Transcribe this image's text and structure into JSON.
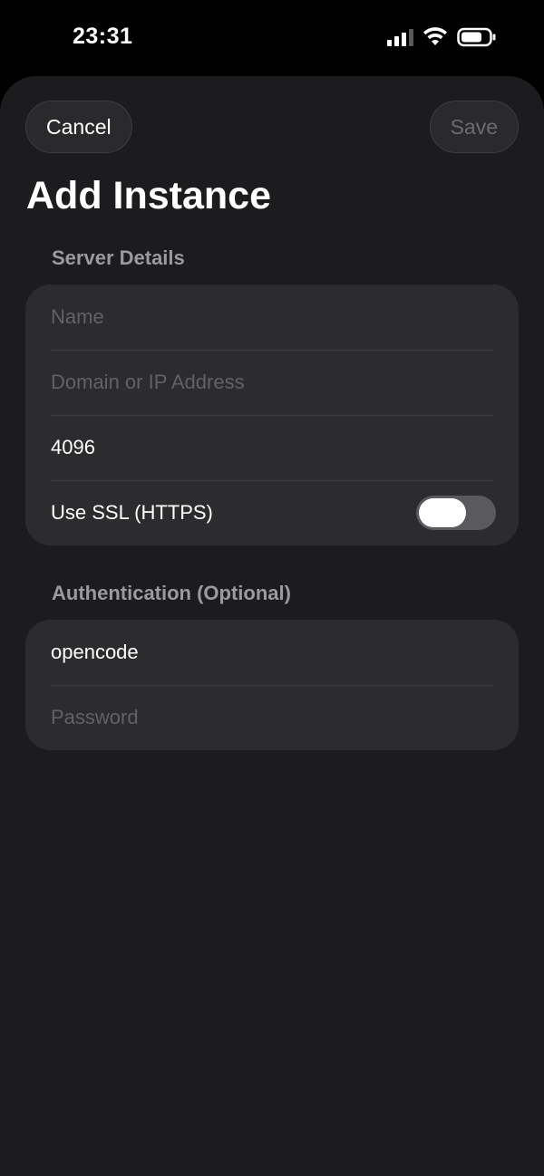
{
  "status_bar": {
    "time": "23:31",
    "icons": [
      "cellular-signal-icon",
      "wifi-icon",
      "battery-icon"
    ]
  },
  "nav": {
    "cancel_label": "Cancel",
    "save_label": "Save"
  },
  "title": "Add Instance",
  "server_details": {
    "header": "Server Details",
    "name_placeholder": "Name",
    "domain_placeholder": "Domain or IP Address",
    "port_value": "4096",
    "ssl_label": "Use SSL (HTTPS)",
    "ssl_enabled": false
  },
  "authentication": {
    "header": "Authentication (Optional)",
    "username_value": "opencode",
    "password_placeholder": "Password"
  },
  "colors": {
    "background": "#1c1c1e",
    "group_background": "#2c2c2e",
    "secondary_text": "#9a9a9f",
    "placeholder_text": "#626266"
  }
}
